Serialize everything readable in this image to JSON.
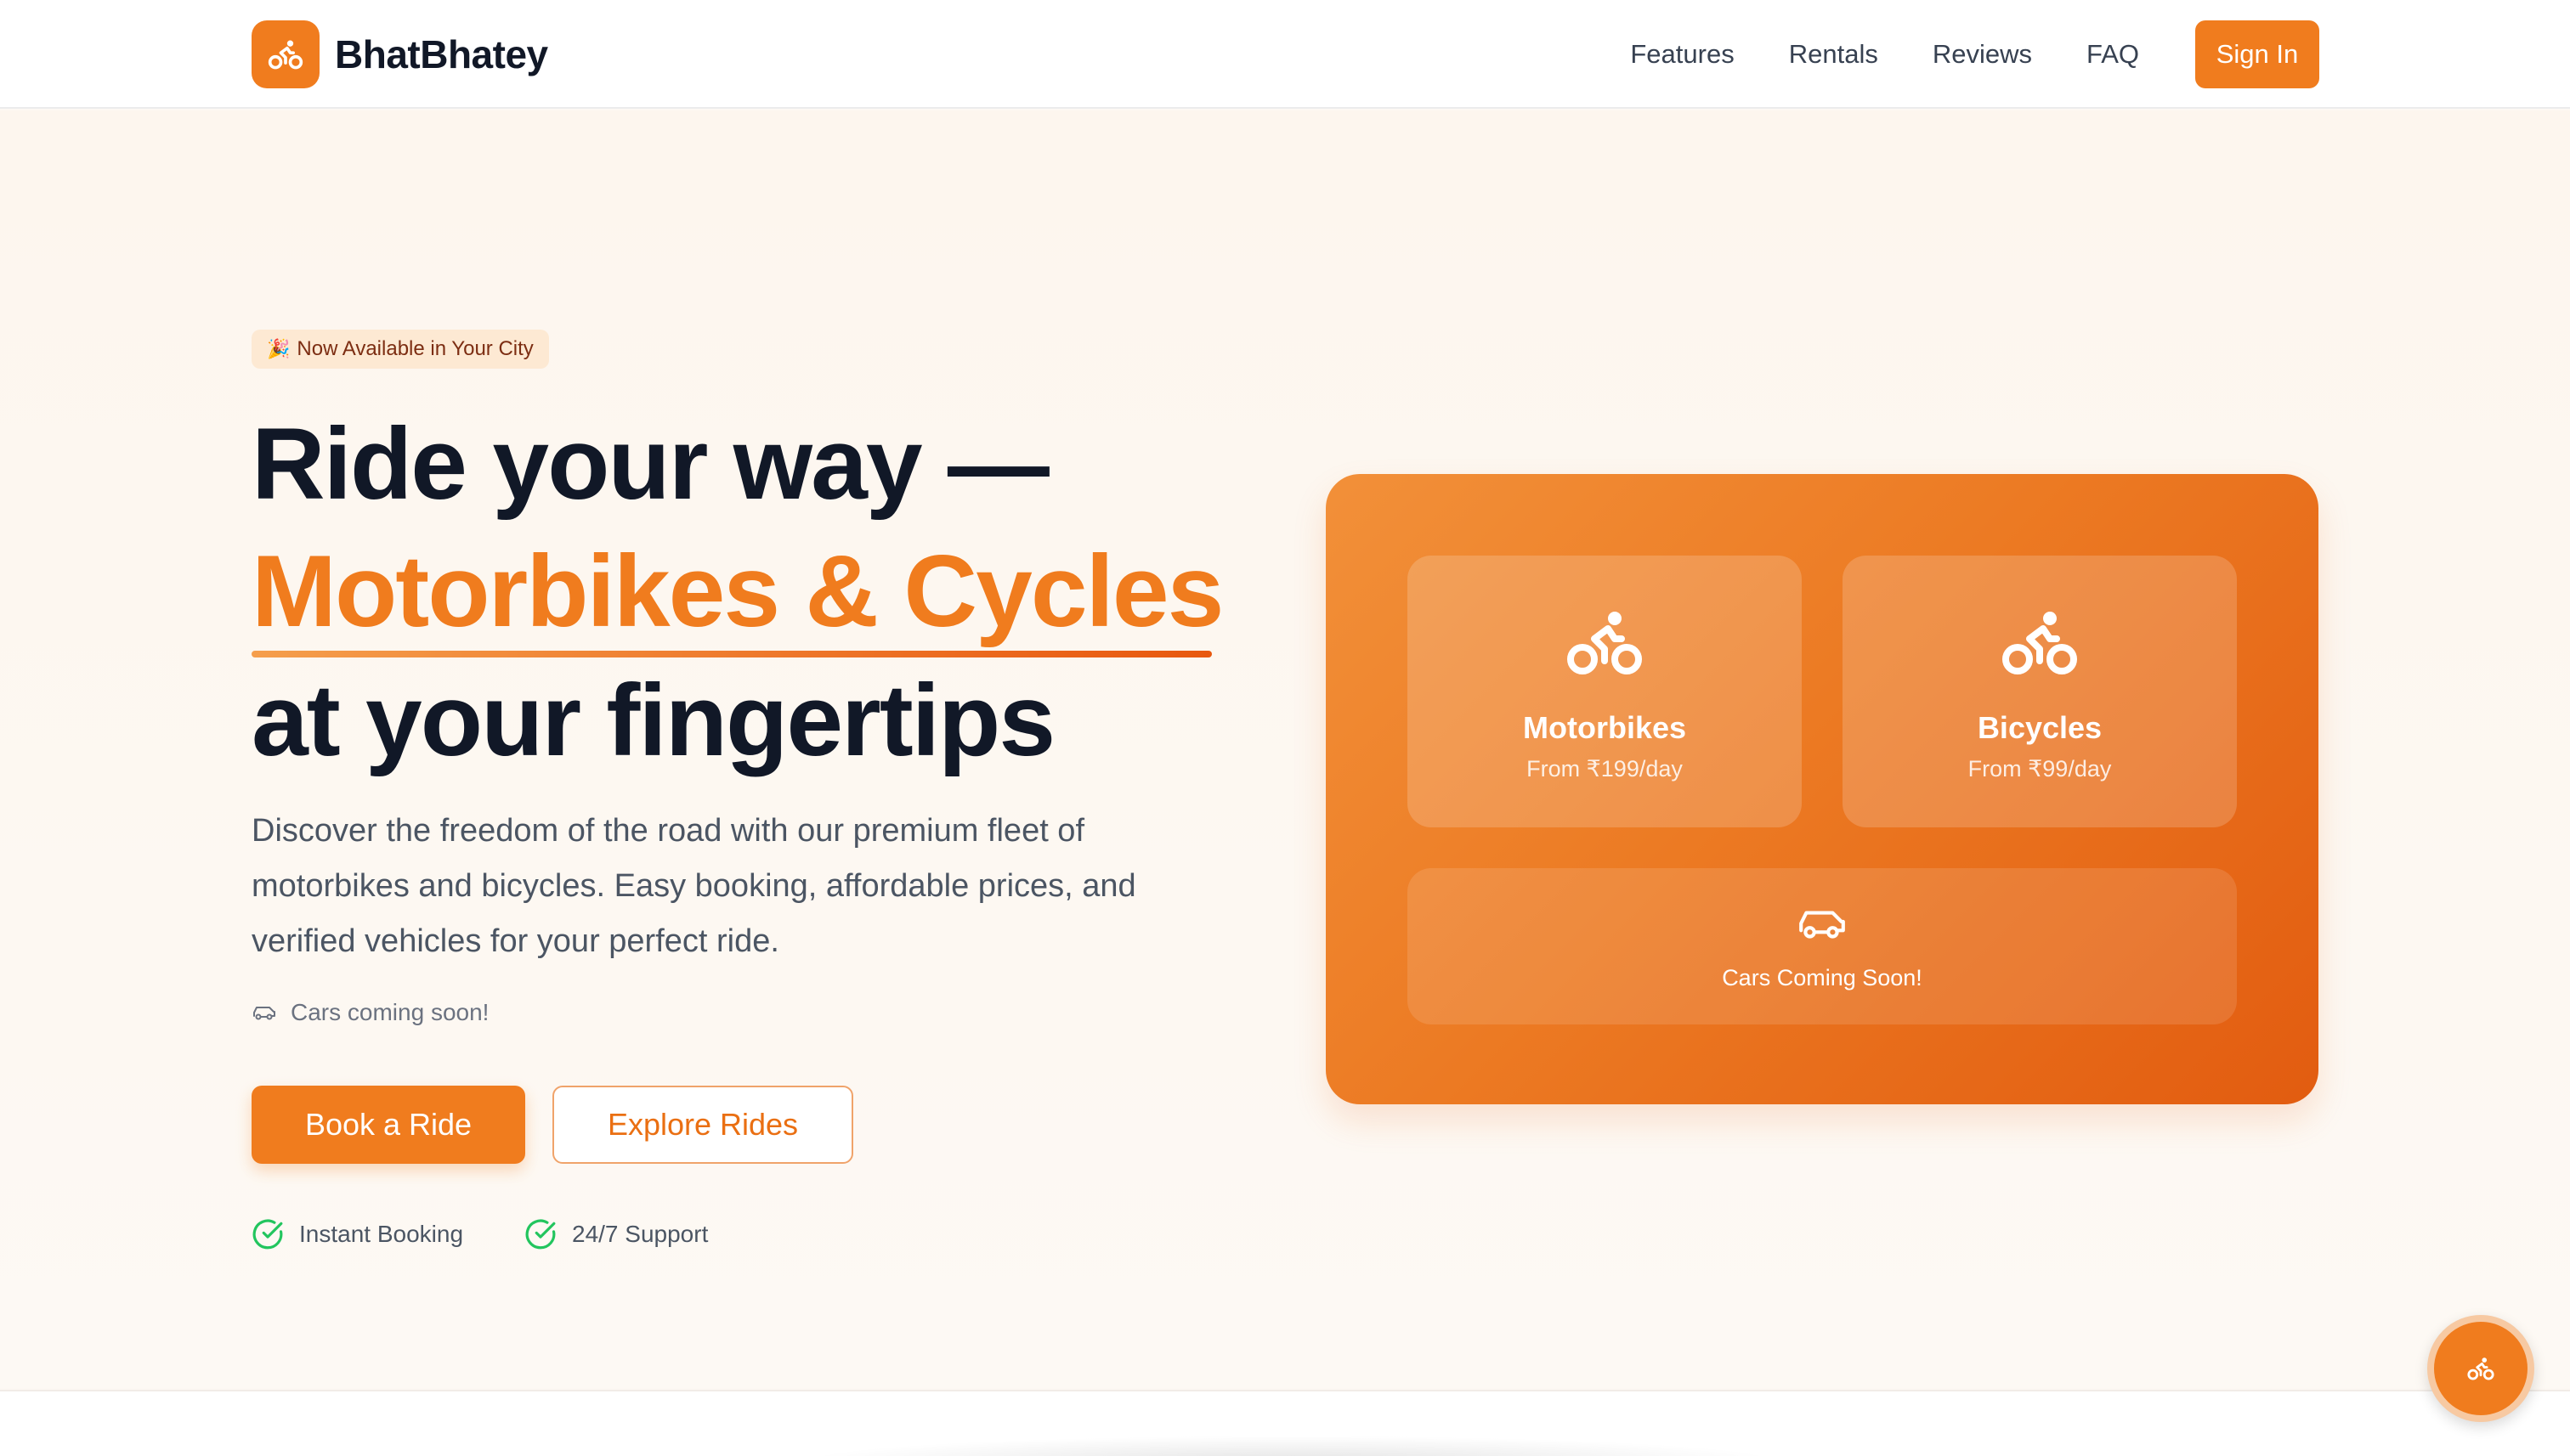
{
  "brand": {
    "name": "BhatBhatey",
    "logo_icon": "bicycle-icon"
  },
  "nav": {
    "links": [
      "Features",
      "Rentals",
      "Reviews",
      "FAQ"
    ],
    "signin_label": "Sign In"
  },
  "hero": {
    "badge": {
      "icon": "🎉",
      "text": "Now Available in Your City"
    },
    "headline": {
      "line1": "Ride your way —",
      "line2": "Motorbikes & Cycles",
      "line3": "at your fingertips"
    },
    "description": "Discover the freedom of the road with our premium fleet of motorbikes and bicycles. Easy booking, affordable prices, and verified vehicles for your perfect ride.",
    "cars_note": "Cars coming soon!",
    "primary_button": "Book a Ride",
    "secondary_button": "Explore Rides",
    "features": [
      "Instant Booking",
      "24/7 Support"
    ]
  },
  "card": {
    "tiles": [
      {
        "icon": "bicycle-icon",
        "title": "Motorbikes",
        "subtitle": "From ₹199/day"
      },
      {
        "icon": "bicycle-icon",
        "title": "Bicycles",
        "subtitle": "From ₹99/day"
      },
      {
        "icon": "car-icon",
        "title": "Cars Coming Soon!"
      }
    ]
  },
  "colors": {
    "accent": "#f07c1e",
    "accent_dark": "#e25c10",
    "text_dark": "#111827",
    "check_green": "#22c55e"
  }
}
